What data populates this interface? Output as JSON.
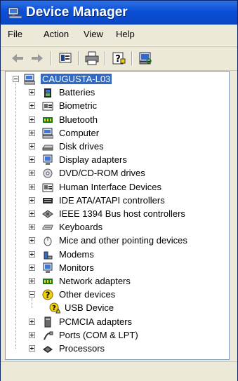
{
  "window": {
    "title": "Device Manager",
    "title_icon": "device-manager-icon"
  },
  "menu": {
    "items": [
      "File",
      "Action",
      "View",
      "Help"
    ]
  },
  "toolbar": {
    "buttons": [
      "back-arrow-icon",
      "forward-arrow-icon",
      "properties-icon",
      "print-icon",
      "help-icon",
      "scan-hardware-icon"
    ]
  },
  "tree": {
    "root": {
      "label": "CAUGUSTA-L03",
      "icon": "computer-icon",
      "expanded": true
    },
    "children": [
      {
        "label": "Batteries",
        "icon": "battery-icon",
        "expanded": false
      },
      {
        "label": "Biometric",
        "icon": "biometric-icon",
        "expanded": false
      },
      {
        "label": "Bluetooth",
        "icon": "bluetooth-icon",
        "expanded": false
      },
      {
        "label": "Computer",
        "icon": "computer-icon",
        "expanded": false
      },
      {
        "label": "Disk drives",
        "icon": "disk-drive-icon",
        "expanded": false
      },
      {
        "label": "Display adapters",
        "icon": "display-adapter-icon",
        "expanded": false
      },
      {
        "label": "DVD/CD-ROM drives",
        "icon": "dvd-drive-icon",
        "expanded": false
      },
      {
        "label": "Human Interface Devices",
        "icon": "hid-icon",
        "expanded": false
      },
      {
        "label": "IDE ATA/ATAPI controllers",
        "icon": "ide-controller-icon",
        "expanded": false
      },
      {
        "label": "IEEE 1394 Bus host controllers",
        "icon": "ieee1394-icon",
        "expanded": false
      },
      {
        "label": "Keyboards",
        "icon": "keyboard-icon",
        "expanded": false
      },
      {
        "label": "Mice and other pointing devices",
        "icon": "mouse-icon",
        "expanded": false
      },
      {
        "label": "Modems",
        "icon": "modem-icon",
        "expanded": false
      },
      {
        "label": "Monitors",
        "icon": "monitor-icon",
        "expanded": false
      },
      {
        "label": "Network adapters",
        "icon": "network-adapter-icon",
        "expanded": false
      },
      {
        "label": "Other devices",
        "icon": "unknown-device-icon",
        "expanded": true,
        "children": [
          {
            "label": "USB Device",
            "icon": "unknown-device-warning-icon"
          }
        ]
      },
      {
        "label": "PCMCIA adapters",
        "icon": "pcmcia-icon",
        "expanded": false
      },
      {
        "label": "Ports (COM & LPT)",
        "icon": "port-icon",
        "expanded": false
      },
      {
        "label": "Processors",
        "icon": "processor-icon",
        "expanded": false
      }
    ]
  },
  "colors": {
    "titlebar": "#0a4fd6",
    "selection": "#316ac5",
    "chrome": "#ece9d8",
    "warning": "#f2d10c"
  }
}
